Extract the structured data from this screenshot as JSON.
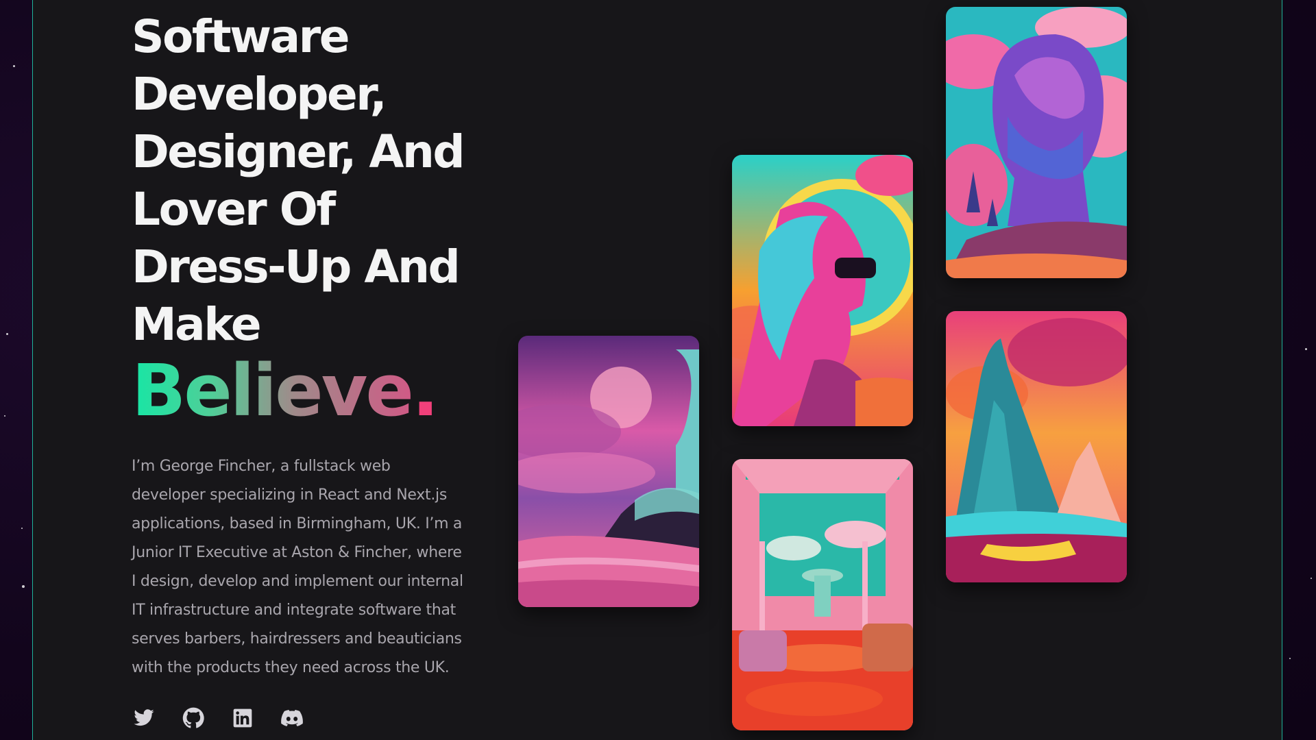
{
  "hero": {
    "headline_lines": [
      "Software",
      "Developer,",
      "Designer, And",
      "Lover Of",
      "Dress-Up And",
      "Make"
    ],
    "accent_word": "Believe",
    "accent_punct": ".",
    "bio_lines": [
      "I’m George Fincher, a fullstack web",
      "developer specializing in React and Next.js",
      "applications, based in Birmingham, UK. I’m a",
      "Junior IT Executive at Aston & Fincher, where",
      "I design, develop and implement our internal",
      "IT infrastructure and integrate software that",
      "serves barbers, hairdressers and beauticians",
      "with the products they need across the UK."
    ]
  },
  "socials": [
    {
      "name": "twitter",
      "icon": "twitter-icon"
    },
    {
      "name": "github",
      "icon": "github-icon"
    },
    {
      "name": "linkedin",
      "icon": "linkedin-icon"
    },
    {
      "name": "discord",
      "icon": "discord-icon"
    }
  ],
  "gallery": [
    {
      "id": "statue-seascape",
      "icon": "artwork-statue-seascape"
    },
    {
      "id": "woman-sunglasses",
      "icon": "artwork-woman-sunglasses"
    },
    {
      "id": "pink-room",
      "icon": "artwork-pink-room"
    },
    {
      "id": "head-cloud",
      "icon": "artwork-head-cloud"
    },
    {
      "id": "mountain-landscape",
      "icon": "artwork-mountain-landscape"
    }
  ],
  "colors": {
    "panel_background": "#171619",
    "outer_background": "#14061f",
    "border_accent": "#1fb39a",
    "headline_text": "#f4f4f4",
    "bio_text": "#a9a6ad",
    "accent_gradient_start": "#17e6a5",
    "accent_gradient_end": "#d05a86",
    "accent_dot": "#f0407a",
    "icon": "#d7d5db"
  }
}
